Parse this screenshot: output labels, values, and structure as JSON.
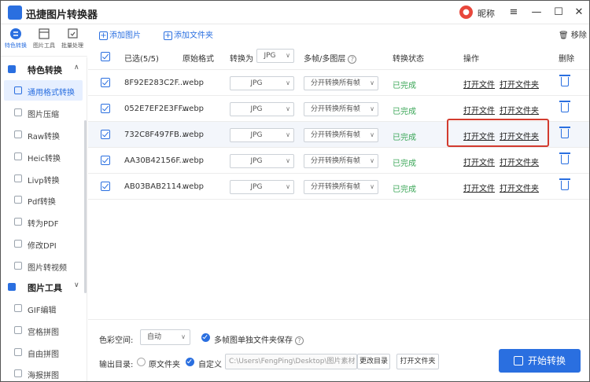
{
  "app": {
    "title": "迅捷图片转换器",
    "nickname": "昵称",
    "avatar_icon": "avatar-icon",
    "window_controls": [
      "≡",
      "—",
      "☐",
      "✕"
    ]
  },
  "rail": {
    "tabs": [
      {
        "label": "特色转换",
        "icon": "special-convert-icon",
        "active": true
      },
      {
        "label": "图片工具",
        "icon": "image-tools-icon",
        "active": false
      },
      {
        "label": "批量处理",
        "icon": "batch-icon",
        "active": false
      }
    ]
  },
  "sidebar": {
    "group1": {
      "label": "特色转换",
      "chevron": "∧"
    },
    "items1": [
      {
        "label": "通用格式转换",
        "active": true
      },
      {
        "label": "图片压缩"
      },
      {
        "label": "Raw转换"
      },
      {
        "label": "Heic转换"
      },
      {
        "label": "Livp转换"
      },
      {
        "label": "Pdf转换"
      },
      {
        "label": "转为PDF"
      },
      {
        "label": "修改DPI"
      },
      {
        "label": "图片转视频"
      }
    ],
    "group2": {
      "label": "图片工具",
      "chevron": "∨"
    },
    "items2": [
      {
        "label": "GIF编辑"
      },
      {
        "label": "宫格拼图"
      },
      {
        "label": "自由拼图"
      },
      {
        "label": "海报拼图"
      }
    ]
  },
  "toolbar": {
    "add_image": "添加图片",
    "add_folder": "添加文件夹",
    "remove": "移除"
  },
  "table": {
    "headers": {
      "selected": "已选(5/5)",
      "format": "原始格式",
      "convert_to": "转换为",
      "convert_to_value": "JPG",
      "multiframe": "多帧/多图层",
      "status": "转换状态",
      "actions": "操作",
      "delete": "删除"
    },
    "rows": [
      {
        "name": "8F92E283C2F...",
        "format": "webp",
        "target": "JPG",
        "frames": "分开转换所有帧",
        "status": "已完成",
        "open_file": "打开文件",
        "open_folder": "打开文件夹"
      },
      {
        "name": "052E7EF2E3FF...",
        "format": "webp",
        "target": "JPG",
        "frames": "分开转换所有帧",
        "status": "已完成",
        "open_file": "打开文件",
        "open_folder": "打开文件夹"
      },
      {
        "name": "732C8F497FB...",
        "format": "webp",
        "target": "JPG",
        "frames": "分开转换所有帧",
        "status": "已完成",
        "open_file": "打开文件",
        "open_folder": "打开文件夹"
      },
      {
        "name": "AA30B42156F...",
        "format": "webp",
        "target": "JPG",
        "frames": "分开转换所有帧",
        "status": "已完成",
        "open_file": "打开文件",
        "open_folder": "打开文件夹"
      },
      {
        "name": "AB03BAB2114...",
        "format": "webp",
        "target": "JPG",
        "frames": "分开转换所有帧",
        "status": "已完成",
        "open_file": "打开文件",
        "open_folder": "打开文件夹"
      }
    ]
  },
  "bottom": {
    "color_space_label": "色彩空间:",
    "color_space_value": "自动",
    "multiframe_save": "多帧图单独文件夹保存",
    "output_label": "输出目录:",
    "original_folder": "原文件夹",
    "custom": "自定义",
    "path": "C:\\Users\\FengPing\\Desktop\\图片素材",
    "change_dir": "更改目录",
    "open_folder": "打开文件夹",
    "start": "开始转换"
  },
  "colors": {
    "accent": "#2a6fe0",
    "success": "#3aa657",
    "highlight": "#d23b2f"
  }
}
